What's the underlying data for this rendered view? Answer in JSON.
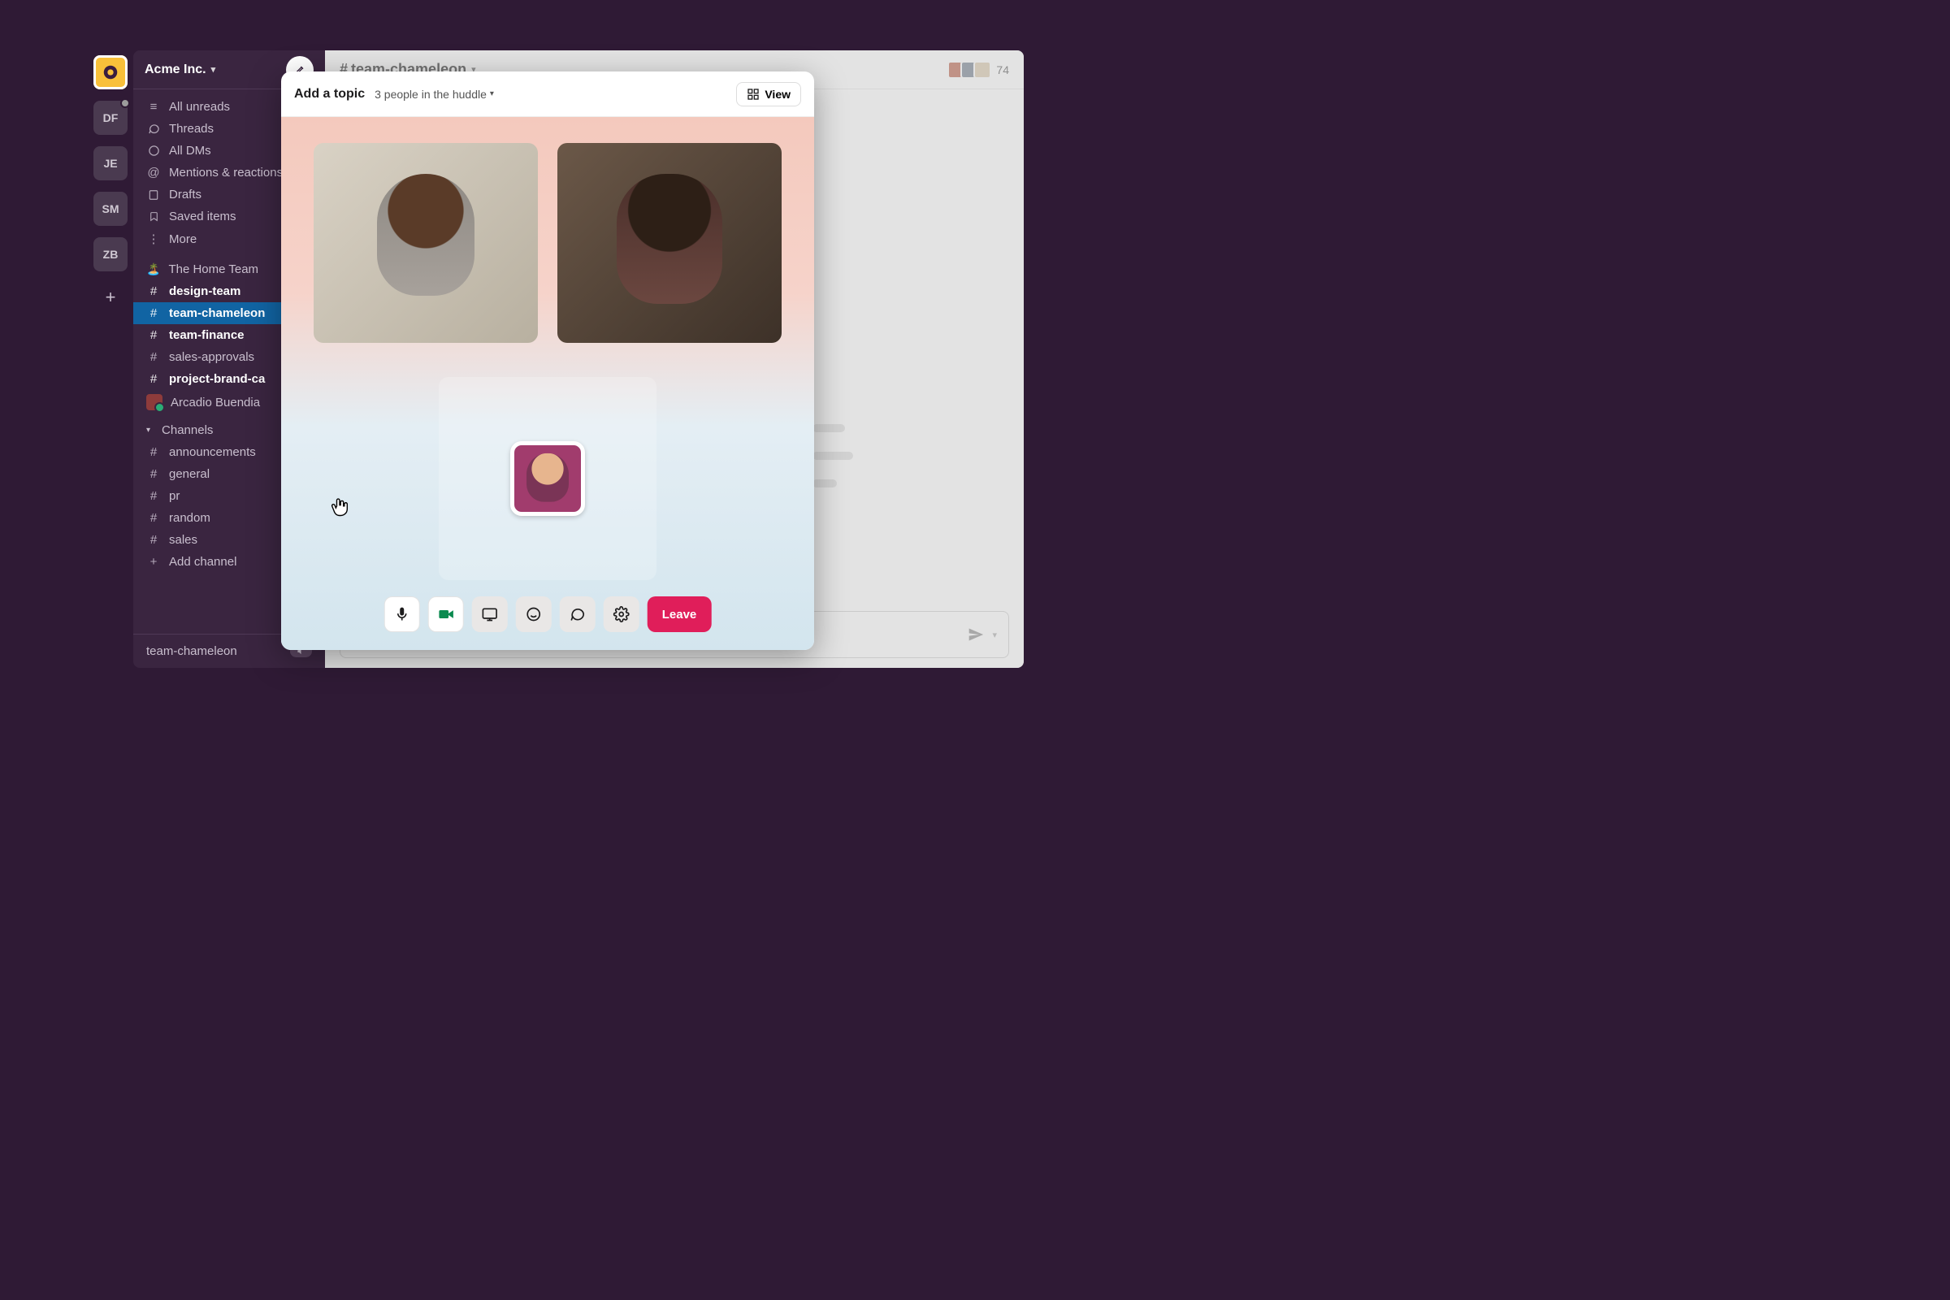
{
  "workspace": {
    "name": "Acme Inc."
  },
  "rail": {
    "items": [
      {
        "initials": "",
        "active": true
      },
      {
        "initials": "DF",
        "presence": true
      },
      {
        "initials": "JE"
      },
      {
        "initials": "SM"
      },
      {
        "initials": "ZB"
      }
    ]
  },
  "sidebar": {
    "nav": [
      {
        "icon": "unreads",
        "label": "All unreads"
      },
      {
        "icon": "threads",
        "label": "Threads"
      },
      {
        "icon": "dms",
        "label": "All DMs"
      },
      {
        "icon": "mentions",
        "label": "Mentions & reactions"
      },
      {
        "icon": "drafts",
        "label": "Drafts"
      },
      {
        "icon": "saved",
        "label": "Saved items"
      },
      {
        "icon": "more",
        "label": "More"
      }
    ],
    "section_home": {
      "emoji": "🏝️",
      "label": "The Home Team"
    },
    "home_channels": [
      {
        "name": "design-team",
        "bold": true
      },
      {
        "name": "team-chameleon",
        "active": true
      },
      {
        "name": "team-finance",
        "bold": true
      },
      {
        "name": "sales-approvals"
      },
      {
        "name": "project-brand-ca",
        "bold": true
      }
    ],
    "dm": {
      "name": "Arcadio Buendia"
    },
    "channels_header": "Channels",
    "channels": [
      {
        "name": "announcements"
      },
      {
        "name": "general"
      },
      {
        "name": "pr"
      },
      {
        "name": "random"
      },
      {
        "name": "sales"
      }
    ],
    "add_channel": "Add channel",
    "footer_channel": "team-chameleon"
  },
  "channel": {
    "name": "team-chameleon",
    "member_count": "74"
  },
  "huddle": {
    "topic_placeholder": "Add a topic",
    "people_text": "3 people in the huddle",
    "view_label": "View",
    "leave_label": "Leave",
    "toolbar": {
      "mic": "microphone",
      "camera": "camera",
      "screen": "share-screen",
      "emoji": "emoji",
      "thread": "thread",
      "settings": "settings"
    }
  }
}
